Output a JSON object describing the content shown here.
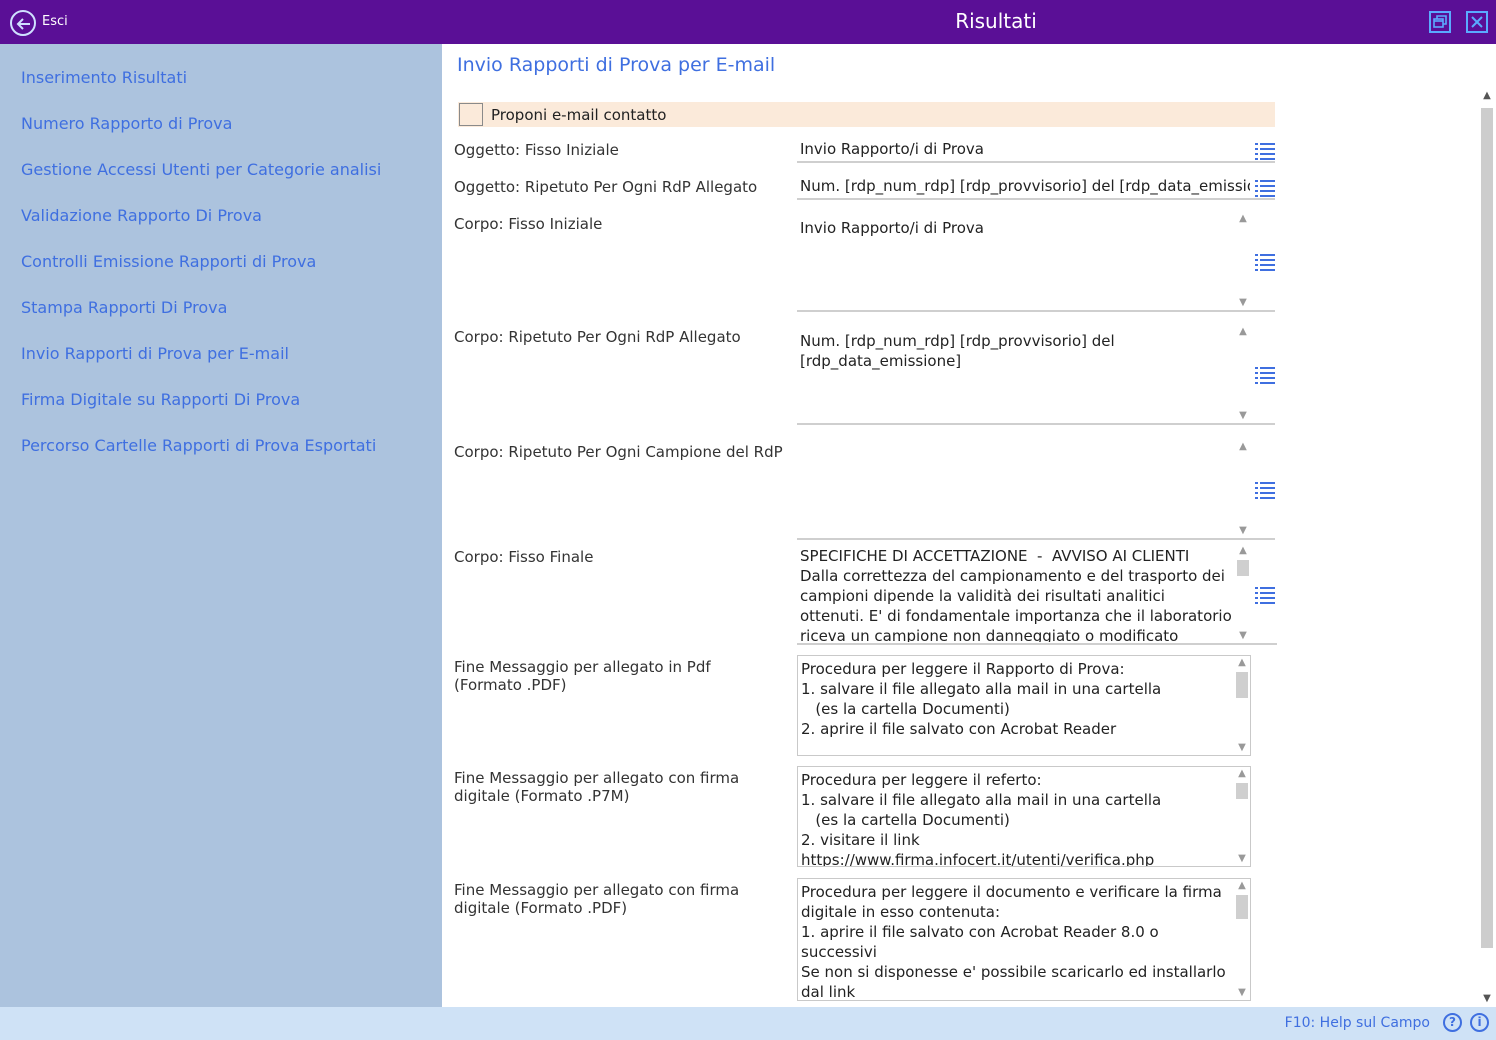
{
  "titlebar": {
    "back_label": "Esci",
    "title": "Risultati"
  },
  "sidebar": {
    "items": [
      {
        "label": "Inserimento Risultati"
      },
      {
        "label": "Numero Rapporto di Prova"
      },
      {
        "label": "Gestione Accessi Utenti per Categorie analisi"
      },
      {
        "label": "Validazione Rapporto Di Prova"
      },
      {
        "label": "Controlli  Emissione Rapporti di Prova"
      },
      {
        "label": "Stampa Rapporti Di Prova"
      },
      {
        "label": "Invio Rapporti di Prova per E-mail"
      },
      {
        "label": "Firma Digitale su Rapporti Di Prova"
      },
      {
        "label": "Percorso Cartelle Rapporti di Prova Esportati"
      }
    ]
  },
  "main": {
    "title": "Invio Rapporti di Prova per E-mail",
    "propose_email_label": "Proponi e-mail contatto",
    "propose_email_checked": false,
    "fields": {
      "subject_initial": {
        "label": "Oggetto: Fisso Iniziale",
        "value": "Invio Rapporto/i di Prova"
      },
      "subject_repeated": {
        "label": "Oggetto: Ripetuto Per Ogni RdP Allegato",
        "value": "Num. [rdp_num_rdp] [rdp_provvisorio] del [rdp_data_emissione]"
      },
      "body_initial": {
        "label": "Corpo: Fisso Iniziale",
        "value": "Invio Rapporto/i di Prova"
      },
      "body_repeated_rdp": {
        "label": "Corpo: Ripetuto Per Ogni RdP Allegato",
        "value": "Num. [rdp_num_rdp] [rdp_provvisorio] del\n[rdp_data_emissione]"
      },
      "body_repeated_sample": {
        "label": "Corpo: Ripetuto Per Ogni Campione del RdP",
        "value": ""
      },
      "body_final": {
        "label": "Corpo: Fisso Finale",
        "value": "SPECIFICHE DI ACCETTAZIONE  -  AVVISO AI CLIENTI\nDalla correttezza del campionamento e del trasporto dei campioni dipende la validità dei risultati analitici ottenuti. E' di fondamentale importanza che il laboratorio riceva un campione non danneggiato o modificato rappresentativo"
      },
      "end_pdf": {
        "label": "Fine Messaggio per allegato in Pdf (Formato .PDF)",
        "value": "Procedura per leggere il Rapporto di Prova:\n1. salvare il file allegato alla mail in una cartella\n   (es la cartella Documenti)\n2. aprire il file salvato con Acrobat Reader"
      },
      "end_p7m": {
        "label": "Fine Messaggio per allegato con firma digitale (Formato .P7M)",
        "value": "Procedura per leggere il referto:\n1. salvare il file allegato alla mail in una cartella\n   (es la cartella Documenti)\n2. visitare il link\nhttps://www.firma.infocert.it/utenti/verifica.php"
      },
      "end_signed_pdf": {
        "label": "Fine Messaggio per allegato con firma digitale (Formato .PDF)",
        "value": "Procedura per leggere il documento e verificare la firma digitale in esso contenuta:\n1. aprire il file salvato con Acrobat Reader 8.0 o successivi\nSe non si disponesse e' possibile scaricarlo ed installarlo dal link\nhttp://www.adobe.com/products/acrobat/main.html"
      }
    }
  },
  "statusbar": {
    "help_label": "F10: Help sul Campo",
    "question_glyph": "?",
    "info_glyph": "i"
  },
  "colors": {
    "titlebar": "#5a0f96",
    "sidebar": "#acc3de",
    "accent": "#3f6fe0",
    "checkbox_row": "#fbeada"
  }
}
